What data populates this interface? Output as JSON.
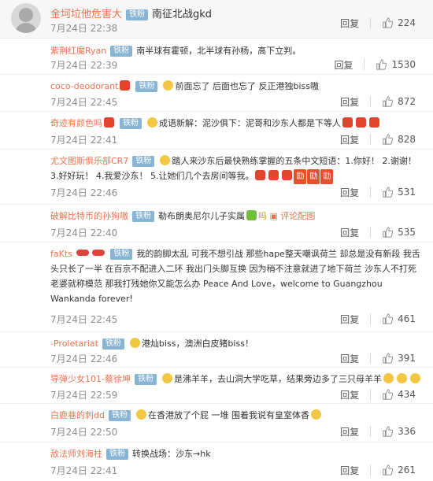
{
  "reply_label": "回复",
  "vip_badge": "铁粉",
  "top": {
    "user": "金坷垃他危害大",
    "badge": "铁粉",
    "text": "南征北战gkd",
    "time": "7月24日 22:38",
    "likes": "224"
  },
  "comments": [
    {
      "user": "紫荆红魔Ryan",
      "text": "南半球有霍顿，北半球有孙杨，高下立判。",
      "time": "7月24日 22:39",
      "likes": "1530"
    },
    {
      "user": "coco-deodorant",
      "text": "前面忘了 后面也忘了 反正港独biss嗷",
      "time": "7月24日 22:45",
      "likes": "872"
    },
    {
      "user": "奇迹有颜色吗",
      "text": "成语新解：泥沙俱下：泥哥和沙东人都是下等人",
      "time": "7月24日 22:41",
      "likes": "828"
    },
    {
      "user": "尤文图斯俱乐部CR7",
      "text": "踏人来沙东后最快熟练掌握的五条中文短语：1.你好！ 2.谢谢！ 3.好好玩！ 4.我爱沙东！ 5.让她们几个去房间等我。",
      "time": "7月24日 22:46",
      "likes": "531"
    },
    {
      "user": "破解比特币的孙狗嗷",
      "text": "勒布朗奥尼尔儿子实属",
      "link": "评论配图",
      "time": "7月24日 22:40",
      "likes": "535"
    },
    {
      "user": "faKts",
      "text": "我的韵脚太乱 可我不想引战 那些hape整天嘲讽荷兰 却总是没有新段 我舌头只长了一半 在百京不配进入二环 我出门头脚互换 因为稍不注意就进了地下荷兰 沙东人不打死老婆就称模范 那我打残她你又能怎么办 Peace And Love，welcome to Guangzhou Wankanda forever!",
      "time": "7月24日 22:45",
      "likes": "461"
    },
    {
      "user": "-Proletariat",
      "text": "港灿biss，澳洲白皮猪biss！",
      "time": "7月24日 22:46",
      "likes": "391"
    },
    {
      "user": "导弹少女101-蔡徐坤",
      "text": "是沸羊羊，去山洞大学吃草，结果旁边多了三只母羊羊",
      "time": "7月24日 22:59",
      "likes": "434"
    },
    {
      "user": "白鹿巷的刺dd",
      "text": "在香港放了个屁 一堆 围着我说有皇室体香",
      "time": "7月24日 22:50",
      "likes": "336"
    },
    {
      "user": "敌法师刘海柱",
      "text": "转换战场：沙东→hk",
      "time": "7月24日 22:41",
      "likes": "261"
    }
  ],
  "quan": "劻"
}
